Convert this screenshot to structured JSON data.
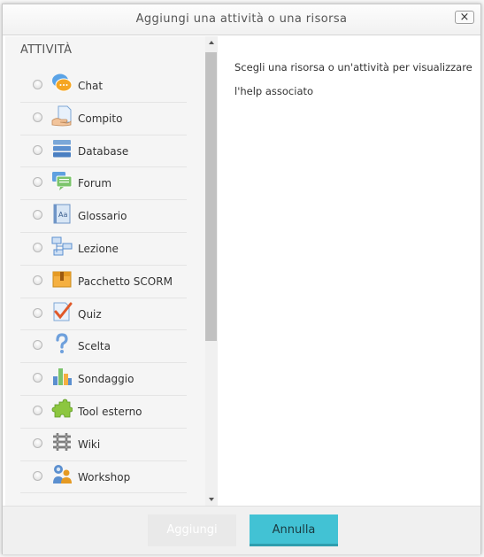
{
  "dialog": {
    "title": "Aggiungi una attività o una risorsa",
    "close_label": "×"
  },
  "left": {
    "section_title": "ATTIVITÀ",
    "options": [
      {
        "label": "Chat",
        "icon": "chat-icon"
      },
      {
        "label": "Compito",
        "icon": "assignment-icon"
      },
      {
        "label": "Database",
        "icon": "database-icon"
      },
      {
        "label": "Forum",
        "icon": "forum-icon"
      },
      {
        "label": "Glossario",
        "icon": "glossary-icon"
      },
      {
        "label": "Lezione",
        "icon": "lesson-icon"
      },
      {
        "label": "Pacchetto SCORM",
        "icon": "scorm-package-icon"
      },
      {
        "label": "Quiz",
        "icon": "quiz-icon"
      },
      {
        "label": "Scelta",
        "icon": "choice-icon"
      },
      {
        "label": "Sondaggio",
        "icon": "survey-icon"
      },
      {
        "label": "Tool esterno",
        "icon": "external-tool-icon"
      },
      {
        "label": "Wiki",
        "icon": "wiki-icon"
      },
      {
        "label": "Workshop",
        "icon": "workshop-icon"
      }
    ]
  },
  "right": {
    "help_text": "Scegli una risorsa o un'attività per visualizzare l'help associato"
  },
  "footer": {
    "add_label": "Aggiungi",
    "cancel_label": "Annulla"
  },
  "colors": {
    "accent": "#42c2d4",
    "disabled_button": "#e9e9e9"
  }
}
